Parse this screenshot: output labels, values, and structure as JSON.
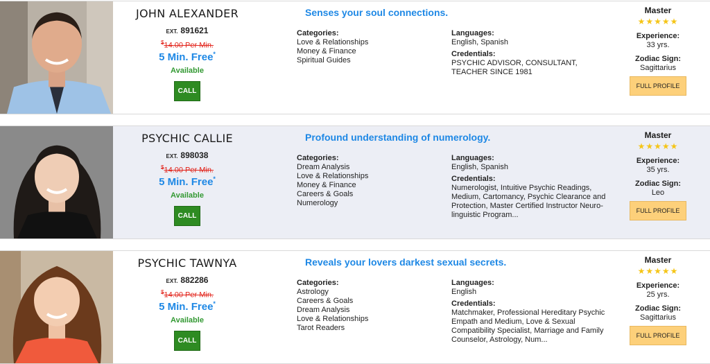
{
  "call_label": "CALL",
  "profile_label": "FULL PROFILE",
  "ext_label": "EXT.",
  "categories_label": "Categories:",
  "languages_label": "Languages:",
  "credentials_label": "Credentials:",
  "experience_label": "Experience:",
  "zodiac_label": "Zodiac Sign:",
  "price_currency": "$",
  "price_text": "14.00 Per Min.",
  "free_text": "5 Min. Free",
  "free_mark": "*",
  "available_text": "Available",
  "stars": "★★★★★",
  "colors": {
    "accent": "#1e88e5",
    "call": "#2e8b22",
    "profile": "#fdd07a",
    "strike": "#e2231a",
    "alt_row": "#eceef5"
  },
  "psychics": [
    {
      "name": "JOHN ALEXANDER",
      "ext": "891621",
      "tagline": "Senses your soul connections.",
      "categories": [
        "Love & Relationships",
        "Money & Finance",
        "Spiritual Guides"
      ],
      "languages": "English, Spanish",
      "credentials": "PSYCHIC ADVISOR, CONSULTANT, TEACHER SINCE 1981",
      "level": "Master",
      "experience": "33 yrs.",
      "zodiac": "Sagittarius"
    },
    {
      "name": "PSYCHIC CALLIE",
      "ext": "898038",
      "tagline": "Profound understanding of numerology.",
      "categories": [
        "Dream Analysis",
        "Love & Relationships",
        "Money & Finance",
        "Careers & Goals",
        "Numerology"
      ],
      "languages": "English, Spanish",
      "credentials": "Numerologist, Intuitive Psychic Readings, Medium, Cartomancy, Psychic Clearance and Protection, Master Certified Instructor Neuro-linguistic Program...",
      "level": "Master",
      "experience": "35 yrs.",
      "zodiac": "Leo"
    },
    {
      "name": "PSYCHIC TAWNYA",
      "ext": "882286",
      "tagline": "Reveals your lovers darkest sexual secrets.",
      "categories": [
        "Astrology",
        "Careers & Goals",
        "Dream Analysis",
        "Love & Relationships",
        "Tarot Readers"
      ],
      "languages": "English",
      "credentials": "Matchmaker, Professional Hereditary Psychic Empath and Medium, Love & Sexual Compatibility Specialist, Marriage and Family Counselor, Astrology, Num...",
      "level": "Master",
      "experience": "25 yrs.",
      "zodiac": "Sagittarius"
    }
  ]
}
